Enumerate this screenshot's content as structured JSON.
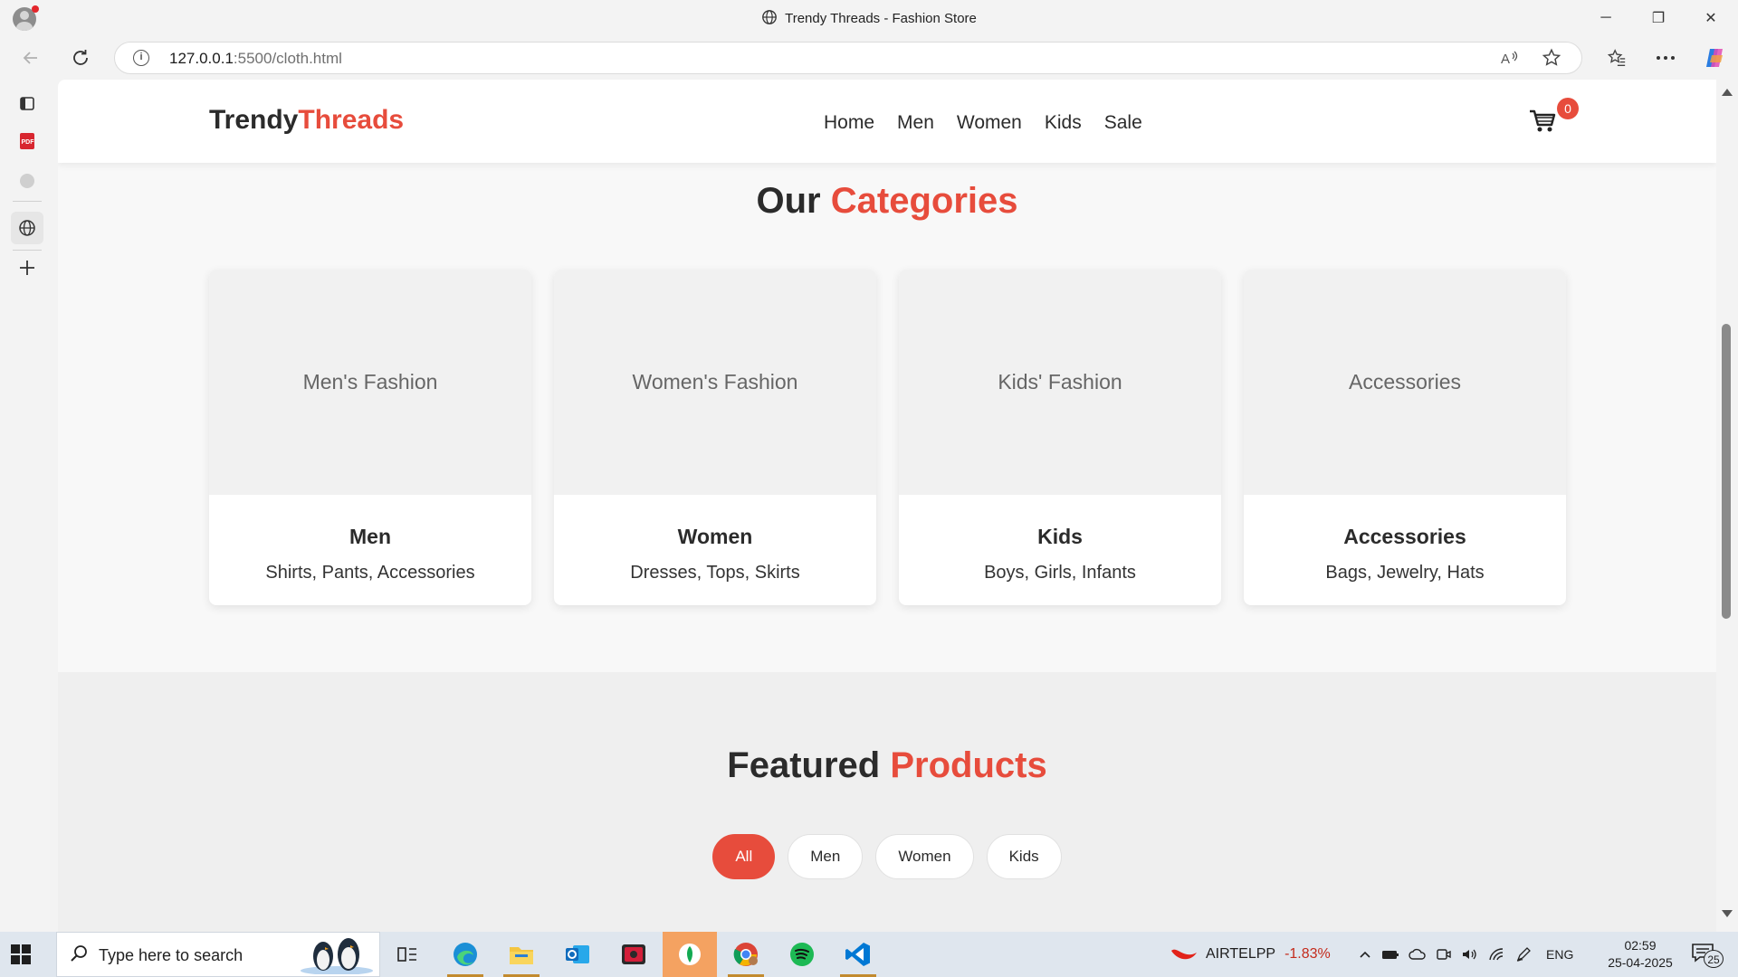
{
  "browser": {
    "window_title": "Trendy Threads - Fashion Store",
    "url_host": "127.0.0.1",
    "url_path": ":5500/cloth.html",
    "window_controls": {
      "minimize": "─",
      "maximize": "❐",
      "close": "✕"
    }
  },
  "site": {
    "logo_part1": "Trendy",
    "logo_part2": "Threads",
    "accent_color": "#e74c3c",
    "nav": [
      "Home",
      "Men",
      "Women",
      "Kids",
      "Sale"
    ],
    "cart_count": "0"
  },
  "categories": {
    "title_part1": "Our",
    "title_part2": "Categories",
    "items": [
      {
        "image_label": "Men's Fashion",
        "name": "Men",
        "subtitle": "Shirts, Pants, Accessories"
      },
      {
        "image_label": "Women's Fashion",
        "name": "Women",
        "subtitle": "Dresses, Tops, Skirts"
      },
      {
        "image_label": "Kids' Fashion",
        "name": "Kids",
        "subtitle": "Boys, Girls, Infants"
      },
      {
        "image_label": "Accessories",
        "name": "Accessories",
        "subtitle": "Bags, Jewelry, Hats"
      }
    ]
  },
  "featured": {
    "title_part1": "Featured",
    "title_part2": "Products",
    "filters": [
      "All",
      "Men",
      "Women",
      "Kids"
    ],
    "active_filter": "All"
  },
  "taskbar": {
    "search_placeholder": "Type here to search",
    "stock_name": "AIRTELPP",
    "stock_change": "-1.83%",
    "language": "ENG",
    "time": "02:59",
    "date": "25-04-2025",
    "notification_count": "25"
  }
}
